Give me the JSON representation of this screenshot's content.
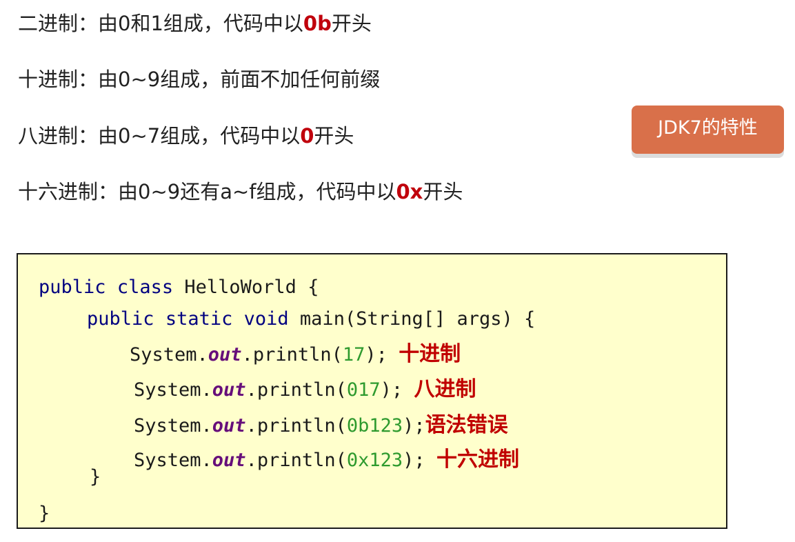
{
  "notes": {
    "binary": {
      "prefix": "二进制：由0和1组成，代码中以",
      "highlight": "0b",
      "suffix": "开头"
    },
    "decimal": {
      "text": "十进制：由0~9组成，前面不加任何前缀"
    },
    "octal": {
      "prefix": "八进制：由0~7组成，代码中以",
      "highlight": "0",
      "suffix": "开头"
    },
    "hex": {
      "prefix": "十六进制：由0~9还有a~f组成，代码中以",
      "highlight": "0x",
      "suffix": "开头"
    }
  },
  "badge": {
    "label": "JDK7的特性",
    "color": "#d9704a"
  },
  "code": {
    "line1": {
      "kw1": "public",
      "kw2": "class",
      "name": "HelloWorld",
      "brace": "{"
    },
    "line2": {
      "kw1": "public",
      "kw2": "static",
      "kw3": "void",
      "sig": "main(String[] args)",
      "brace": "{"
    },
    "statements": [
      {
        "obj": "System.",
        "field": "out",
        "call": ".println(",
        "arg": "17",
        "end": ");",
        "comment": "十进制"
      },
      {
        "obj": "System.",
        "field": "out",
        "call": ".println(",
        "arg": "017",
        "end": ");",
        "comment": "八进制"
      },
      {
        "obj": "System.",
        "field": "out",
        "call": ".println(",
        "arg": "0b123",
        "end": ");",
        "comment": "语法错误"
      },
      {
        "obj": "System.",
        "field": "out",
        "call": ".println(",
        "arg": "0x123",
        "end": ");",
        "comment": "十六进制"
      }
    ],
    "close_inner": "}",
    "close_outer": "}"
  },
  "colors": {
    "highlight": "#c0000c",
    "keyword": "#000080",
    "field": "#660e7a",
    "number": "#2e9a2e",
    "code_background": "#ffffcc"
  }
}
